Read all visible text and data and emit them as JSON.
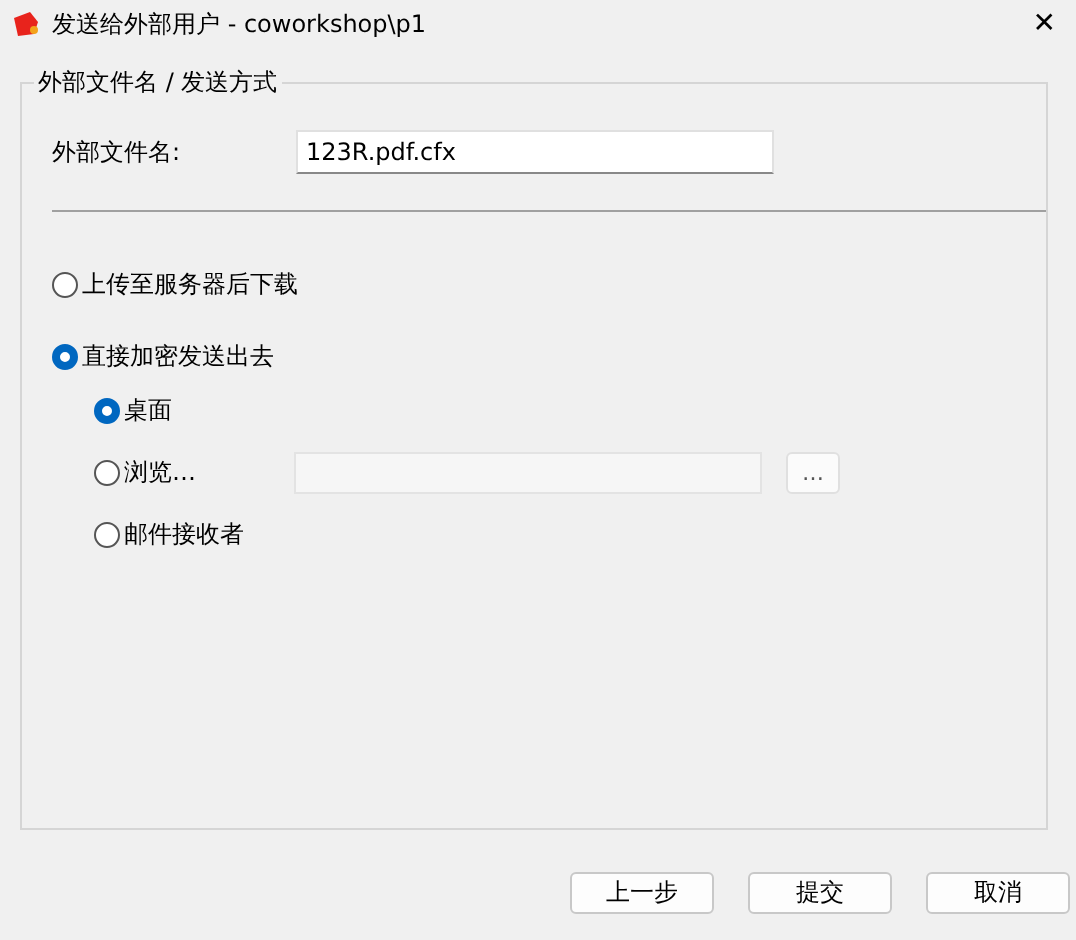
{
  "window": {
    "title": "发送给外部用户 - coworkshop\\p1",
    "close": "✕"
  },
  "group": {
    "legend": "外部文件名 / 发送方式",
    "filename": {
      "label": "外部文件名:",
      "value": "123R.pdf.cfx"
    },
    "options": [
      {
        "label": "上传至服务器后下载",
        "selected": false
      },
      {
        "label": "直接加密发送出去",
        "selected": true,
        "children": [
          {
            "kind": "plain",
            "label": "桌面",
            "selected": true
          },
          {
            "kind": "browse",
            "label": "浏览…",
            "selected": false,
            "field": {
              "disabled": true
            },
            "button": "…"
          },
          {
            "kind": "plain",
            "label": "邮件接收者",
            "selected": false
          }
        ]
      }
    ]
  },
  "buttons": [
    "上一步",
    "提交",
    "取消"
  ]
}
